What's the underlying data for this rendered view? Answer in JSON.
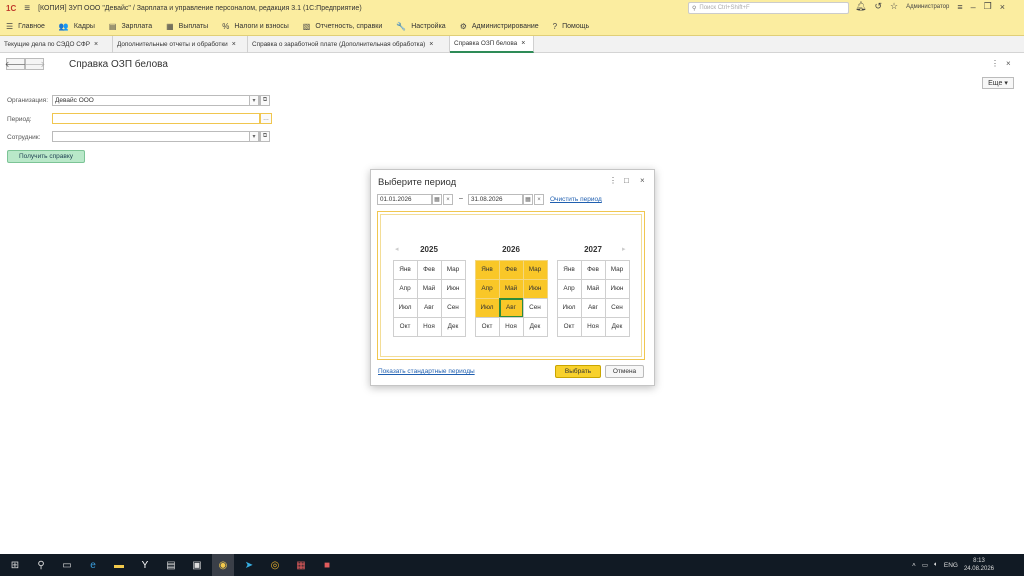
{
  "titlebar": {
    "logo": "1С",
    "title": "[КОПИЯ] ЗУП ООО \"Девайс\" / Зарплата и управление персоналом, редакция 3.1  (1С:Предприятие)",
    "search_placeholder": "Поиск Ctrl+Shift+F",
    "user": "Администратор"
  },
  "menu": [
    {
      "icon": "☰",
      "label": "Главное"
    },
    {
      "icon": "👥",
      "label": "Кадры"
    },
    {
      "icon": "▤",
      "label": "Зарплата"
    },
    {
      "icon": "▦",
      "label": "Выплаты"
    },
    {
      "icon": "%",
      "label": "Налоги и взносы"
    },
    {
      "icon": "▧",
      "label": "Отчетность, справки"
    },
    {
      "icon": "🔧",
      "label": "Настройка"
    },
    {
      "icon": "⚙",
      "label": "Администрирование"
    },
    {
      "icon": "?",
      "label": "Помощь"
    }
  ],
  "tabs": [
    {
      "label": "Текущие дела по СЭДО СФР",
      "close": "×"
    },
    {
      "label": "Дополнительные отчеты и обработки",
      "close": "×"
    },
    {
      "label": "Справка о заработной плате (Дополнительная обработка)",
      "close": "×"
    },
    {
      "label": "Справка ОЗП белова",
      "close": "×"
    }
  ],
  "form": {
    "title": "Справка ОЗП белова",
    "more_label": "Еще",
    "org_label": "Организация:",
    "org_value": "Девайс ООО",
    "period_label": "Период:",
    "period_value": "",
    "employee_label": "Сотрудник:",
    "employee_value": "",
    "get_button": "Получить справку"
  },
  "dialog": {
    "title": "Выберите период",
    "date_from": "01.01.2026",
    "dash": "–",
    "date_to": "31.08.2026",
    "clear_link": "Очистить период",
    "standard_link": "Показать стандартные периоды",
    "select_button": "Выбрать",
    "cancel_button": "Отмена",
    "years": [
      {
        "year": "2025",
        "months": [
          "Янв",
          "Фев",
          "Мар",
          "Апр",
          "Май",
          "Июн",
          "Июл",
          "Авг",
          "Сен",
          "Окт",
          "Ноя",
          "Дек"
        ],
        "selected_count": 0,
        "current_index": -1
      },
      {
        "year": "2026",
        "months": [
          "Янв",
          "Фев",
          "Мар",
          "Апр",
          "Май",
          "Июн",
          "Июл",
          "Авг",
          "Сен",
          "Окт",
          "Ноя",
          "Дек"
        ],
        "selected_count": 8,
        "current_index": 7
      },
      {
        "year": "2027",
        "months": [
          "Янв",
          "Фев",
          "Мар",
          "Апр",
          "Май",
          "Июн",
          "Июл",
          "Авг",
          "Сен",
          "Окт",
          "Ноя",
          "Дек"
        ],
        "selected_count": 0,
        "current_index": -1
      }
    ]
  },
  "taskbar": {
    "lang": "ENG",
    "time": "8:13",
    "date": "24.08.2026"
  },
  "colors": {
    "accent_yellow": "#fbeda0",
    "selected_month": "#f9c728",
    "current_border": "#2e8b3a",
    "link": "#1f5fb0"
  }
}
